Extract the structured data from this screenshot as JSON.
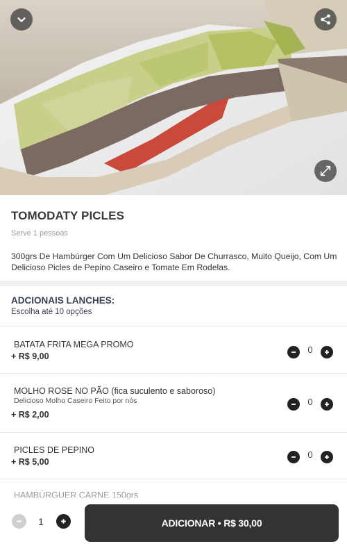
{
  "hero": {
    "back_icon": "chevron-down-icon",
    "share_icon": "share-icon",
    "expand_icon": "expand-icon"
  },
  "product": {
    "title": "TOMODATY PICLES",
    "serves": "Serve 1 pessoas",
    "description": "300grs De Hambúrger Com Um Delicioso Sabor De Churrasco, Muito Queijo, Com Um Delicioso Picles de Pepino Caseiro e Tomate Em Rodelas."
  },
  "addons": {
    "title": "ADCIONAIS LANCHES:",
    "subtitle": "Escolha até 10 opções",
    "items": [
      {
        "name": "BATATA FRITA MEGA PROMO",
        "note": "",
        "price": "+ R$ 9,00",
        "qty": "0"
      },
      {
        "name": "MOLHO ROSE NO PÃO (fica suculento e saboroso)",
        "note": "Delicioso Molho Caseiro Feito por nós",
        "price": "+ R$ 2,00",
        "qty": "0"
      },
      {
        "name": "PICLES DE PEPINO",
        "note": "",
        "price": "+ R$ 5,00",
        "qty": "0"
      },
      {
        "name": "HAMBÚRGUER CARNE 150grs",
        "note": "",
        "price": "",
        "qty": ""
      }
    ]
  },
  "footer": {
    "quantity": "1",
    "add_label": "ADICIONAR • R$ 30,00"
  },
  "colors": {
    "button_dark": "#333333",
    "divider": "#efefef"
  }
}
